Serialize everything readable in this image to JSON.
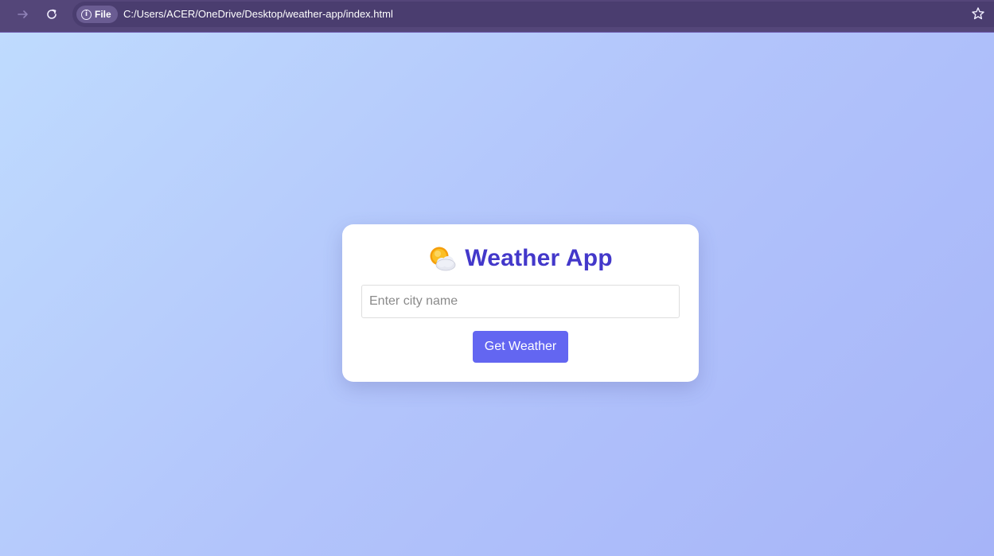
{
  "browser": {
    "scheme_chip": "File",
    "url": "C:/Users/ACER/OneDrive/Desktop/weather-app/index.html",
    "icons": {
      "forward": "arrow-right-icon",
      "reload": "reload-icon",
      "info": "info-icon",
      "bookmark": "star-icon"
    }
  },
  "app": {
    "title_icon": "sun-behind-cloud-icon",
    "title": "Weather App",
    "city_input": {
      "placeholder": "Enter city name",
      "value": ""
    },
    "submit_label": "Get Weather",
    "colors": {
      "title": "#4338ca",
      "button": "#6366f1",
      "toolbar": "#544679"
    }
  }
}
